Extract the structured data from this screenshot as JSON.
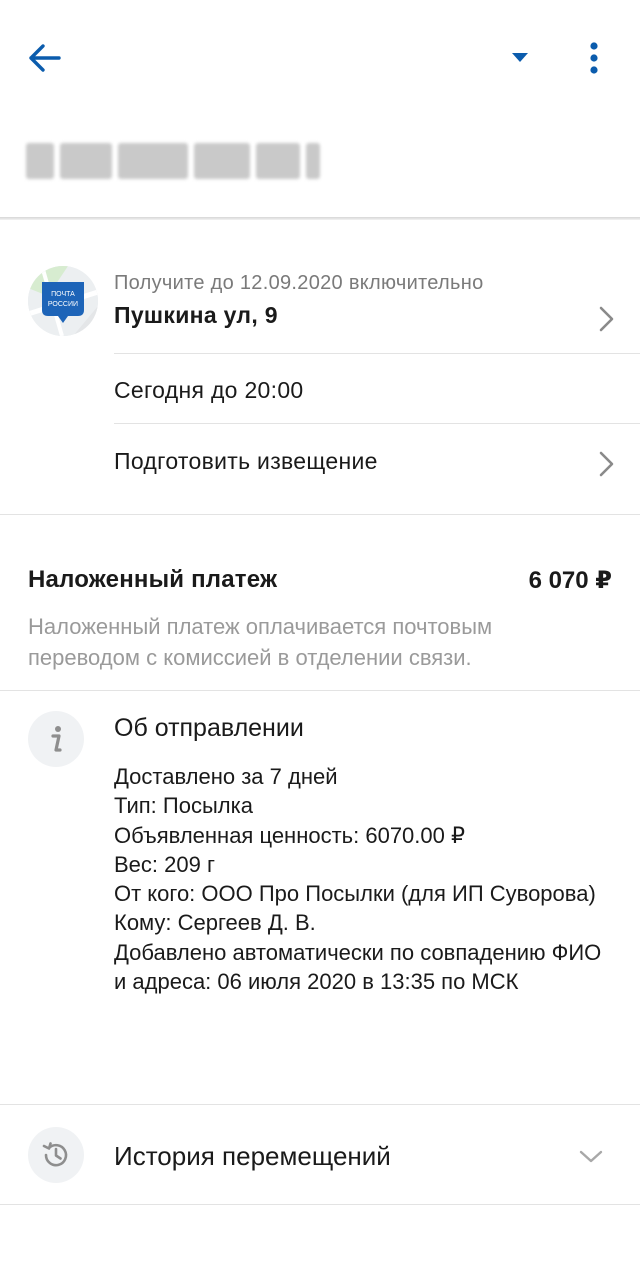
{
  "icons": {
    "back": "arrow-left-icon",
    "dropdown": "caret-down-icon",
    "more": "more-vertical-icon",
    "logo": "post-office-logo",
    "chevron_right": "chevron-right-icon",
    "info": "info-icon",
    "history": "history-icon",
    "chevron_down": "chevron-down-icon"
  },
  "colors": {
    "accent": "#0b5cad",
    "text": "#1a1a1a",
    "muted": "#9a9a9a"
  },
  "logo": {
    "line1": "ПОЧТА",
    "line2": "РОССИИ"
  },
  "pickup": {
    "deadline": "Получите до 12.09.2020 включительно",
    "address": "Пушкина ул, 9",
    "hours": "Сегодня до 20:00",
    "prepare_notice": "Подготовить извещение"
  },
  "cod": {
    "title": "Наложенный платеж",
    "amount": "6 070 ₽",
    "description": "Наложенный платеж оплачивается почтовым переводом с комиссией в отделении связи."
  },
  "about": {
    "title": "Об отправлении",
    "lines": [
      "Доставлено за 7 дней",
      "Тип: Посылка",
      "Объявленная ценность: 6070.00 ₽",
      "Вес: 209 г",
      "От кого: ООО Про Посылки (для ИП Суворова)",
      "Кому: Сергеев Д. В.",
      "Добавлено автоматически по совпадению ФИО и адреса: 06 июля 2020 в 13:35 по МСК"
    ]
  },
  "history": {
    "title": "История перемещений"
  }
}
